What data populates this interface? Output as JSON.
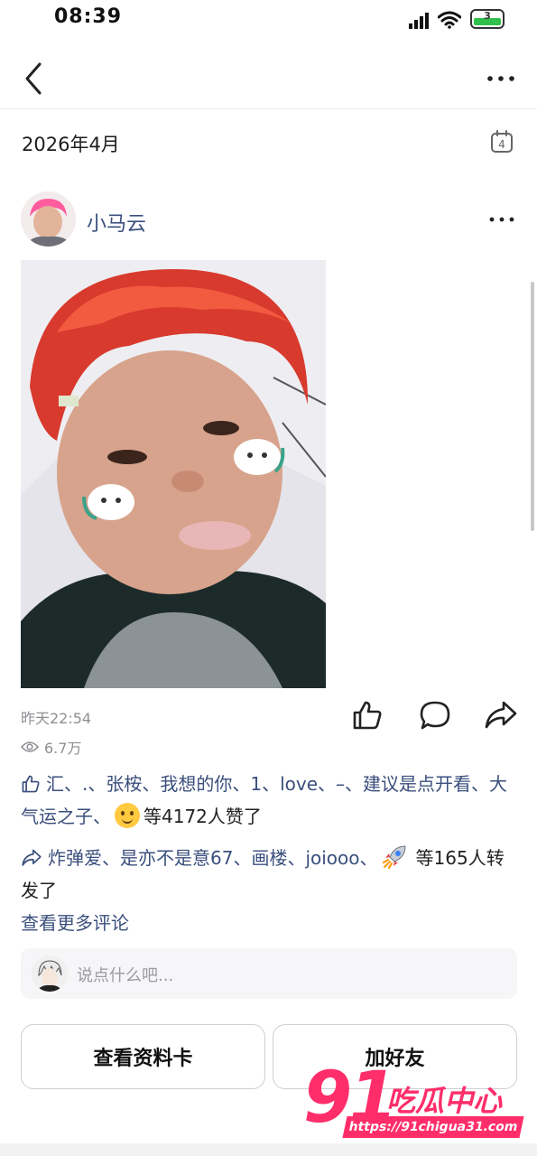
{
  "status_bar": {
    "time": "08:39",
    "battery_level": "3"
  },
  "header": {
    "month": "2026年4月",
    "calendar_day": "4"
  },
  "post": {
    "author": "小马云",
    "time": "昨天22:54",
    "views": "6.7万"
  },
  "likes": {
    "names": "汇、.、张桉、我想的你、1、love、–、建议是点开看、大气运之子、",
    "tail": "等4172人赞了"
  },
  "shares": {
    "names": "炸弹爱、是亦不是意67、画楼、joiooo、",
    "tail": "等165人转发了"
  },
  "comments": {
    "more_label": "查看更多评论",
    "placeholder": "说点什么吧..."
  },
  "buttons": {
    "profile_card": "查看资料卡",
    "add_friend": "加好友"
  },
  "watermark": {
    "logo_number": "91",
    "logo_text": "吃瓜中心",
    "url": "https://91chigua31.com"
  },
  "colors": {
    "link": "#3b4f7d",
    "watermark": "#ff2e6a",
    "battery": "#2fbf4a"
  }
}
